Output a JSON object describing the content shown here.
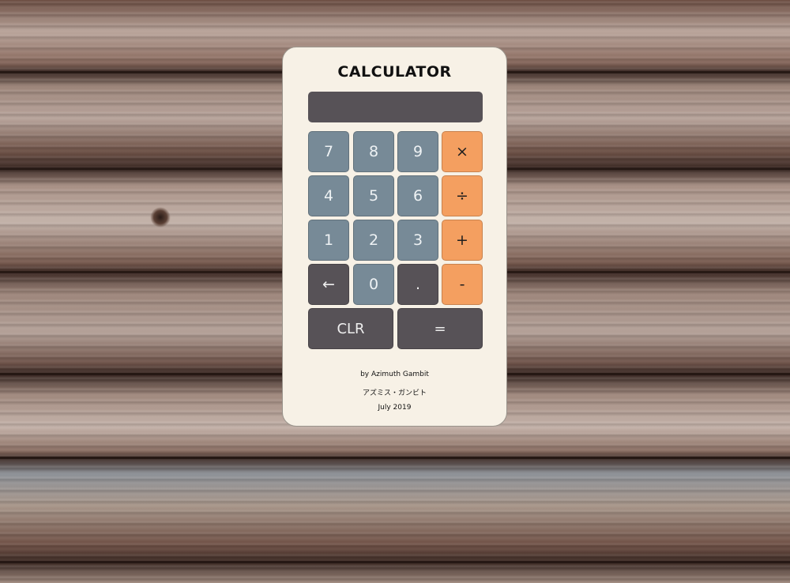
{
  "calculator": {
    "title": "CALCULATOR",
    "display_value": "",
    "keys": {
      "seven": "7",
      "eight": "8",
      "nine": "9",
      "multiply": "×",
      "four": "4",
      "five": "5",
      "six": "6",
      "divide": "÷",
      "one": "1",
      "two": "2",
      "three": "3",
      "add": "+",
      "backspace": "←",
      "zero": "0",
      "decimal": ".",
      "subtract": "-",
      "clear": "CLR",
      "equals": "="
    }
  },
  "footer": {
    "author": "by Azimuth Gambit",
    "author_katakana": "アズミス・ガンビト",
    "date": "July 2019"
  },
  "colors": {
    "card_background": "#f7f1e6",
    "number_key": "#778a97",
    "operator_key": "#f49f60",
    "dark_key": "#575257",
    "background": "wood-planks"
  }
}
